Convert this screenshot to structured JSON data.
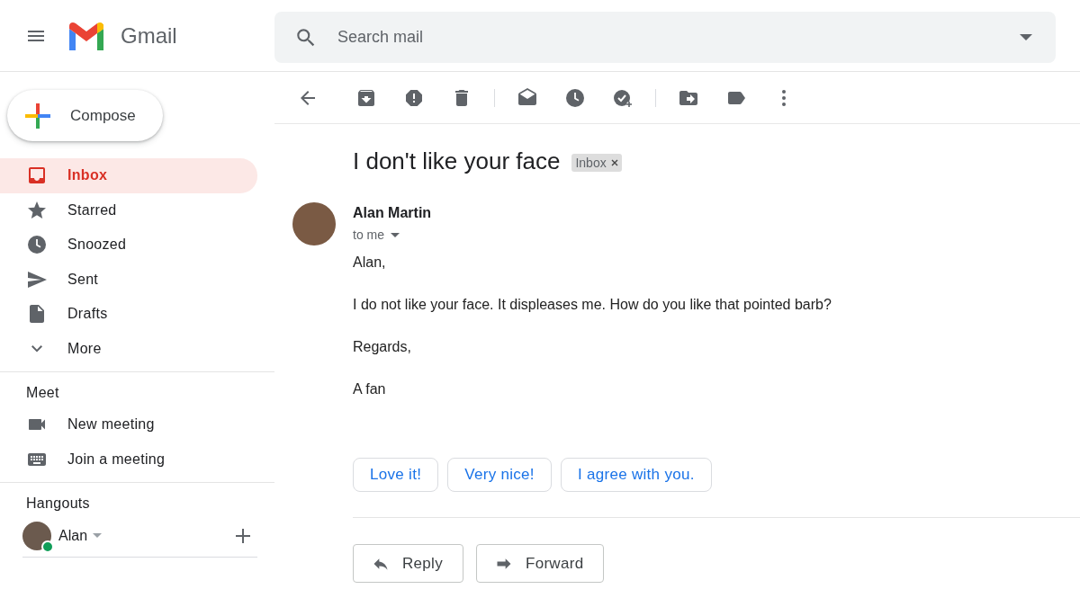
{
  "app": {
    "name": "Gmail"
  },
  "search": {
    "placeholder": "Search mail"
  },
  "compose": "Compose",
  "nav": [
    {
      "label": "Inbox",
      "kind": "inbox",
      "selected": true
    },
    {
      "label": "Starred",
      "kind": "star",
      "selected": false
    },
    {
      "label": "Snoozed",
      "kind": "clock",
      "selected": false
    },
    {
      "label": "Sent",
      "kind": "send",
      "selected": false
    },
    {
      "label": "Drafts",
      "kind": "draft",
      "selected": false
    },
    {
      "label": "More",
      "kind": "chevron",
      "selected": false
    }
  ],
  "meet": {
    "title": "Meet",
    "items": [
      {
        "label": "New meeting",
        "kind": "video"
      },
      {
        "label": "Join a meeting",
        "kind": "keyboard"
      }
    ]
  },
  "hangouts": {
    "title": "Hangouts",
    "user": {
      "name": "Alan",
      "online": true
    }
  },
  "message": {
    "subject": "I don't like your face",
    "label": "Inbox",
    "sender": "Alan Martin",
    "recipient": "to me",
    "body": [
      "Alan,",
      "I do not like your face. It displeases me. How do you like that pointed barb?",
      "Regards,",
      "A fan"
    ],
    "smart_replies": [
      "Love it!",
      "Very nice!",
      "I agree with you."
    ],
    "actions": [
      {
        "label": "Reply",
        "kind": "reply"
      },
      {
        "label": "Forward",
        "kind": "forward"
      }
    ]
  }
}
